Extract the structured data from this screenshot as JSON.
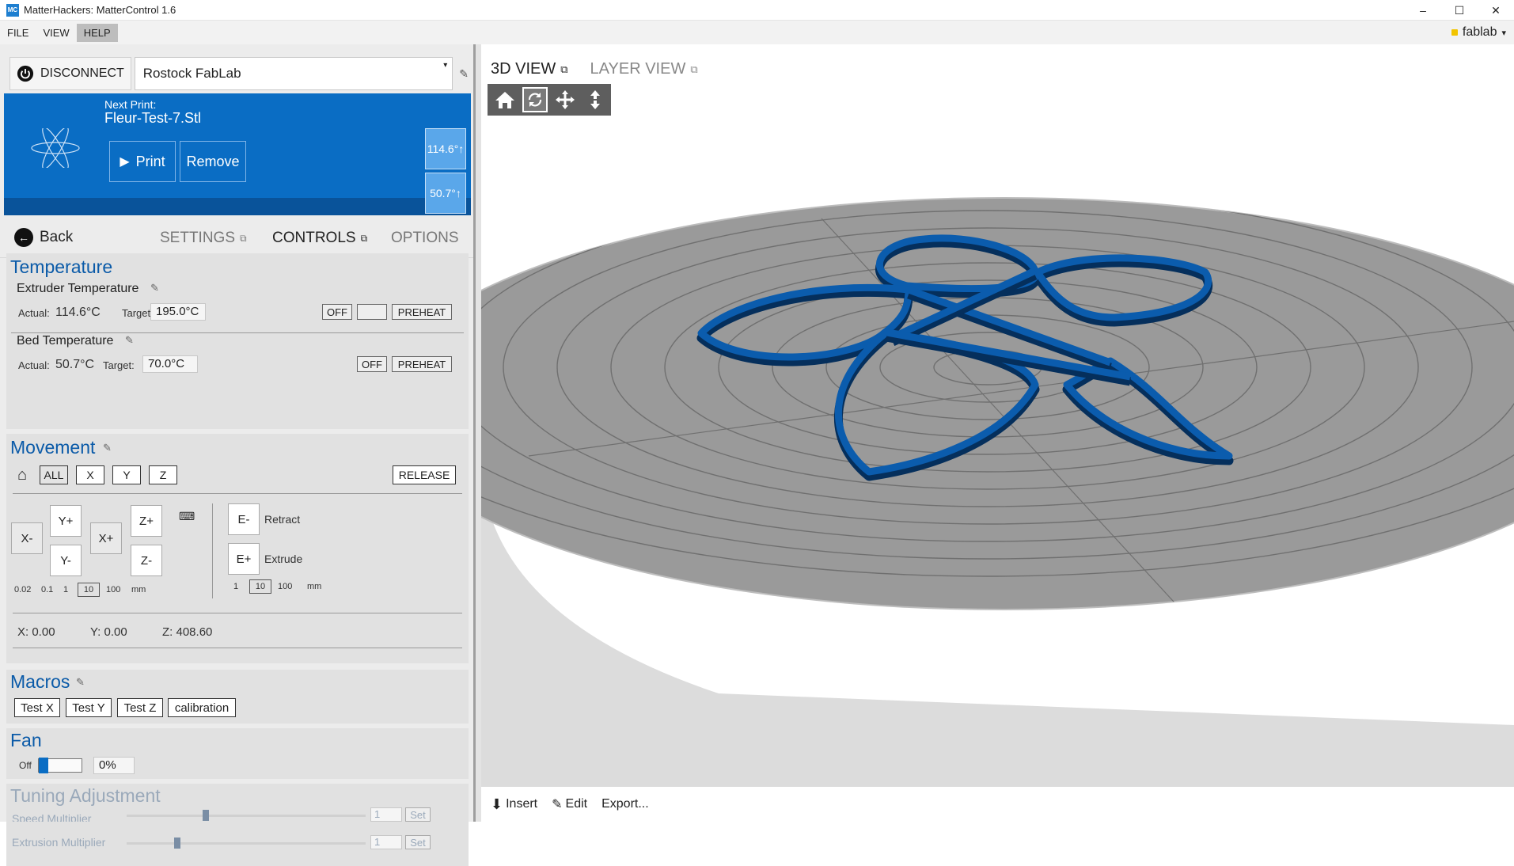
{
  "window": {
    "title": "MatterHackers: MatterControl 1.6",
    "app_icon_text": "MC",
    "controls": [
      "–",
      "☐",
      "✕"
    ]
  },
  "menubar": {
    "items": [
      "FILE",
      "VIEW",
      "HELP"
    ],
    "active": "HELP",
    "user": "fablab",
    "user_caret": "▾"
  },
  "connection": {
    "disconnect_label": "DISCONNECT",
    "printer_name": "Rostock FabLab",
    "caret": "▾",
    "edit_icon": "✎"
  },
  "next_print": {
    "label": "Next Print:",
    "file": "Fleur-Test-7.Stl",
    "print_label": "Print",
    "remove_label": "Remove",
    "extruder_temp": "114.6°↑",
    "bed_temp": "50.7°↑"
  },
  "tabs": {
    "back_label": "Back",
    "items": [
      "SETTINGS",
      "CONTROLS",
      "OPTIONS"
    ],
    "active": "CONTROLS",
    "popout_icon": "⧉"
  },
  "temperature": {
    "title": "Temperature",
    "extruder": {
      "label": "Extruder Temperature",
      "actual_label": "Actual:",
      "actual_value": "114.6°C",
      "target_label": "Target:",
      "target_value": "195.0°C",
      "off_label": "OFF",
      "preheat_label": "PREHEAT"
    },
    "bed": {
      "label": "Bed Temperature",
      "actual_label": "Actual:",
      "actual_value": "50.7°C",
      "target_label": "Target:",
      "target_value": "70.0°C",
      "off_label": "OFF",
      "preheat_label": "PREHEAT"
    }
  },
  "movement": {
    "title": "Movement",
    "home_buttons": [
      "ALL",
      "X",
      "Y",
      "Z"
    ],
    "release_label": "RELEASE",
    "jog": {
      "x_minus": "X-",
      "x_plus": "X+",
      "y_plus": "Y+",
      "y_minus": "Y-",
      "z_plus": "Z+",
      "z_minus": "Z-",
      "e_minus": "E-",
      "e_plus": "E+",
      "retract_label": "Retract",
      "extrude_label": "Extrude"
    },
    "xy_steps": [
      "0.02",
      "0.1",
      "1",
      "10",
      "100"
    ],
    "xy_step_selected": "10",
    "e_steps": [
      "1",
      "10",
      "100"
    ],
    "e_step_selected": "10",
    "unit": "mm",
    "position": {
      "x": "X: 0.00",
      "y": "Y: 0.00",
      "z": "Z: 408.60"
    }
  },
  "macros": {
    "title": "Macros",
    "items": [
      "Test X",
      "Test Y",
      "Test Z",
      "calibration"
    ]
  },
  "fan": {
    "title": "Fan",
    "off_label": "Off",
    "speed_value": "0%",
    "speed_fraction": 0.0
  },
  "tuning": {
    "title": "Tuning Adjustment",
    "speed_label": "Speed Multiplier",
    "speed_value": "1",
    "extrusion_label": "Extrusion Multiplier",
    "extrusion_value": "1",
    "set_label": "Set"
  },
  "view3d": {
    "tabs": [
      "3D VIEW",
      "LAYER VIEW"
    ],
    "active": "3D VIEW",
    "toolbar": [
      "home-icon",
      "rotate-icon",
      "move-icon",
      "zoom-icon"
    ],
    "active_tool": "rotate-icon",
    "bed_color": "#9a9a9a",
    "part_color": "#0b5cad",
    "bottom": {
      "insert_label": "Insert",
      "edit_label": "Edit",
      "export_label": "Export..."
    }
  }
}
